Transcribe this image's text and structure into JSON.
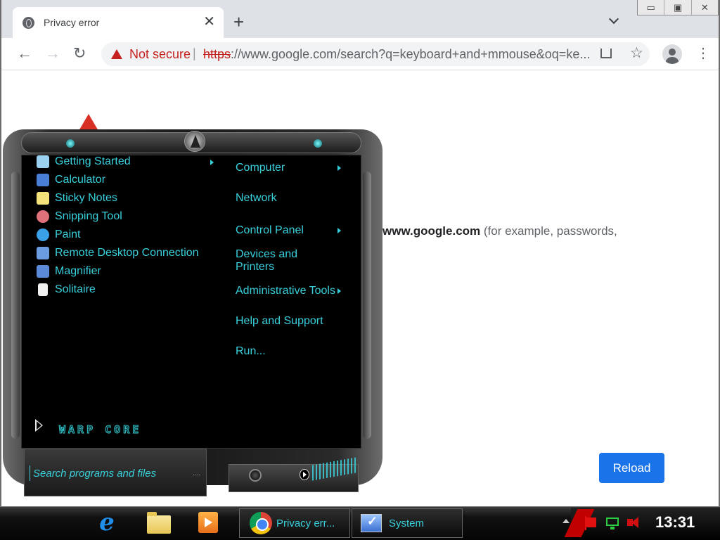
{
  "browser": {
    "tab_title": "Privacy error",
    "tab_close": "✕",
    "new_tab": "+",
    "window_controls": {
      "minimize": "▭",
      "maximize": "▣",
      "close": "✕"
    },
    "nav": {
      "back": "←",
      "forward": "→",
      "reload": "↻"
    },
    "omnibox": {
      "security_label": "Not secure",
      "separator": "|",
      "url_scheme": "https",
      "url_rest": "://www.google.com/search?q=keyboard+and+mmouse&oq=ke..."
    },
    "star": "☆",
    "menu": "⋮"
  },
  "page": {
    "domain_bold": "www.google.com",
    "text_rest": " (for example, passwords,",
    "reload_label": "Reload"
  },
  "start_menu": {
    "programs": [
      {
        "label": "Getting Started",
        "icon": "getting-started-icon",
        "color": "#9ad0f0"
      },
      {
        "label": "Calculator",
        "icon": "calculator-icon",
        "color": "#4a7fd8"
      },
      {
        "label": "Sticky Notes",
        "icon": "sticky-notes-icon",
        "color": "#f4e27a"
      },
      {
        "label": "Snipping Tool",
        "icon": "snipping-tool-icon",
        "color": "#e0707a"
      },
      {
        "label": "Paint",
        "icon": "paint-icon",
        "color": "#3aa0e8"
      },
      {
        "label": "Remote Desktop Connection",
        "icon": "remote-desktop-icon",
        "color": "#6c9ce0"
      },
      {
        "label": "Magnifier",
        "icon": "magnifier-icon",
        "color": "#5a8ad8"
      },
      {
        "label": "Solitaire",
        "icon": "solitaire-icon",
        "color": "#f0f0f0"
      }
    ],
    "places": [
      {
        "label": "Computer",
        "has_arrow": true
      },
      {
        "label": "Network",
        "has_arrow": false
      },
      {
        "label": "Control Panel",
        "has_arrow": true
      },
      {
        "label": "Devices and Printers",
        "has_arrow": false
      },
      {
        "label": "Administrative Tools",
        "has_arrow": true
      },
      {
        "label": "Help and Support",
        "has_arrow": false
      },
      {
        "label": "Run...",
        "has_arrow": false
      }
    ],
    "brand": "WARP CORE",
    "search_placeholder": "Search programs and files",
    "search_more": "...."
  },
  "taskbar": {
    "tasks": [
      {
        "label": "Privacy err...",
        "icon": "chrome-icon"
      },
      {
        "label": "System",
        "icon": "system-icon"
      }
    ],
    "clock": "13:31"
  },
  "colors": {
    "menu_text": "#38d0dc",
    "not_secure": "#c5221f",
    "reload_button": "#1a73e8"
  }
}
